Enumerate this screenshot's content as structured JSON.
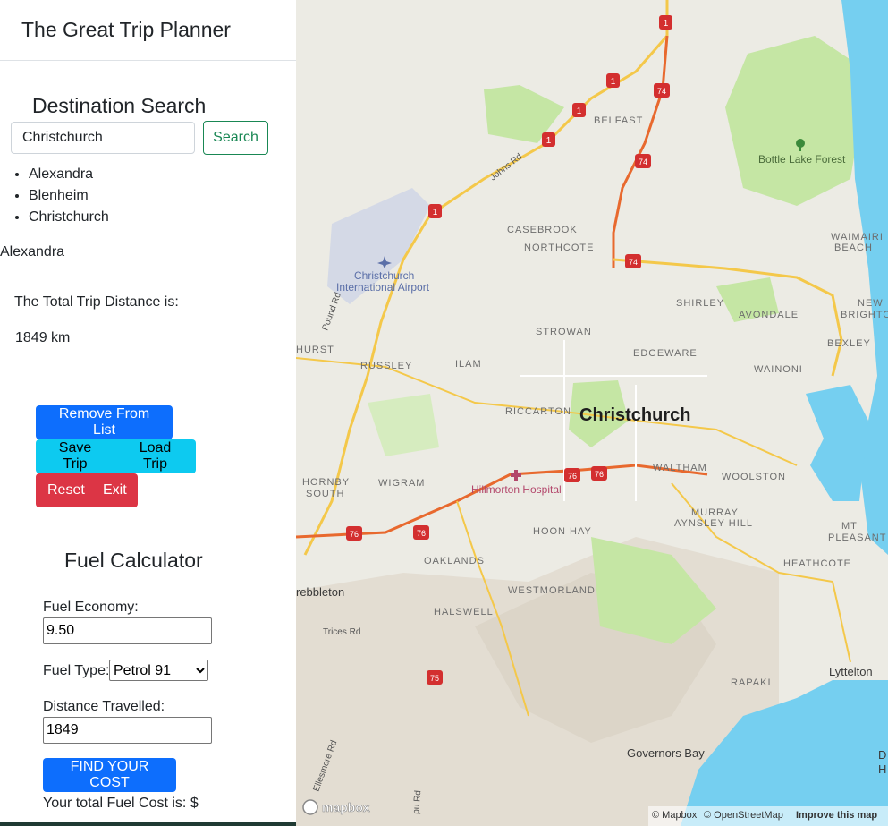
{
  "app": {
    "title": "The Great Trip Planner"
  },
  "search": {
    "heading": "Destination Search",
    "input_value": "Christchurch",
    "button_label": "Search",
    "results": [
      "Alexandra",
      "Blenheim",
      "Christchurch"
    ]
  },
  "trip": {
    "selected_destination": "Alexandra",
    "distance_label": "The Total Trip Distance is:",
    "distance_value": "1849 km"
  },
  "actions": {
    "remove": "Remove From List",
    "save": "Save Trip",
    "load": "Load Trip",
    "reset": "Reset",
    "exit": "Exit"
  },
  "fuel": {
    "heading": "Fuel Calculator",
    "economy_label": "Fuel Economy:",
    "economy_value": "9.50",
    "type_label": "Fuel Type:",
    "type_value": "Petrol 91",
    "distance_label": "Distance Travelled:",
    "distance_value": "1849",
    "button_label": "FIND YOUR COST",
    "result_text": "Your total Fuel Cost is: $"
  },
  "map": {
    "city_label": "Christchurch",
    "places": {
      "belfast": "BELFAST",
      "bottle_lake": "Bottle Lake Forest",
      "casebrook": "CASEBROOK",
      "northcote": "NORTHCOTE",
      "waimairi": "WAIMAIRI",
      "beach": "BEACH",
      "airport_1": "Christchurch",
      "airport_2": "International Airport",
      "shirley": "SHIRLEY",
      "avondale": "AVONDALE",
      "new": "NEW",
      "brighton": "BRIGHTO",
      "strowan": "STROWAN",
      "bexley": "BEXLEY",
      "hurst": "HURST",
      "russley": "RUSSLEY",
      "ilam": "ILAM",
      "edgeware": "EDGEWARE",
      "wainoni": "WAINONI",
      "riccarton": "RICCARTON",
      "hornby_1": "HORNBY",
      "hornby_2": "SOUTH",
      "wigram": "WIGRAM",
      "hospital": "Hillmorton Hospital",
      "waltham": "WALTHAM",
      "woolston": "WOOLSTON",
      "murray_1": "MURRAY",
      "murray_2": "AYNSLEY HILL",
      "mt_1": "MT",
      "mt_2": "PLEASANT",
      "hoon_hay": "HOON HAY",
      "templeton": "rebbleton",
      "oaklands": "OAKLANDS",
      "heathcote": "HEATHCOTE",
      "westmorland": "WESTMORLAND",
      "halswell": "HALSWELL",
      "rapaki": "RAPAKI",
      "lyttelton": "Lyttelton",
      "governors_bay": "Governors Bay",
      "da": "D",
      "h": "H"
    },
    "roads": {
      "johns": "Johns Rd",
      "pound": "Pound Rd",
      "trices": "Trices Rd",
      "ellesmere": "Ellesmere Rd",
      "pu": "pu Rd"
    },
    "shields": {
      "sh1": "1",
      "sh74": "74",
      "sh76": "76",
      "sh75": "75"
    },
    "logo": "mapbox",
    "attribution_mapbox": "© Mapbox",
    "attribution_osm": "© OpenStreetMap",
    "improve_link": "Improve this map"
  },
  "colors": {
    "primary": "#0d6efd",
    "info": "#0dcaf0",
    "danger": "#dc3545",
    "success": "#198754",
    "water": "#75cff0",
    "park": "#c5e6a4",
    "motorway": "#e8692e",
    "road": "#f4c84a"
  }
}
